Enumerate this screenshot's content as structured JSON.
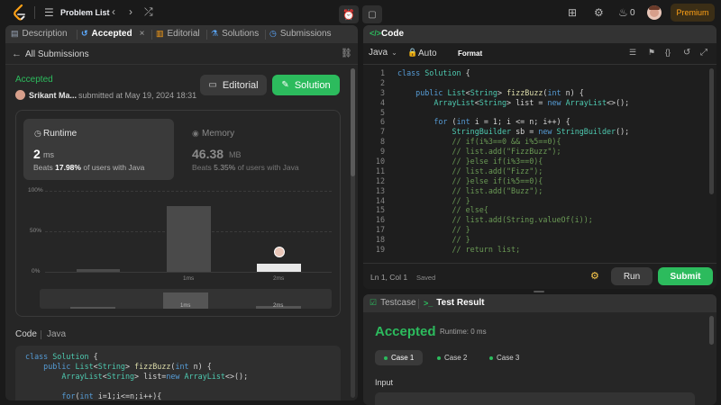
{
  "topbar": {
    "problem_list": "Problem List",
    "streak_count": "0",
    "premium_label": "Premium"
  },
  "left": {
    "tabs": [
      {
        "label": "Description"
      },
      {
        "label": "Accepted"
      },
      {
        "label": "Editorial"
      },
      {
        "label": "Solutions"
      },
      {
        "label": "Submissions"
      }
    ],
    "back_label": "All Submissions",
    "status": "Accepted",
    "user": "Srikant Ma...",
    "submitted": "submitted at May 19, 2024 18:31",
    "editorial_btn": "Editorial",
    "solution_btn": "Solution",
    "runtime": {
      "title": "Runtime",
      "value": "2",
      "unit": "ms",
      "beats_prefix": "Beats",
      "beats_pct": "17.98%",
      "beats_suffix": "of users with Java"
    },
    "memory": {
      "title": "Memory",
      "value": "46.38",
      "unit": "MB",
      "beats_prefix": "Beats",
      "beats_pct": "5.35%",
      "beats_suffix": "of users with Java"
    },
    "chart": {
      "y_ticks": [
        "100%",
        "50%",
        "0%"
      ],
      "x_labels": [
        "1ms",
        "2ms"
      ],
      "mini_labels": [
        "1ms",
        "2ms"
      ]
    },
    "code_label": "Code",
    "code_lang": "Java",
    "code_preview": [
      "class Solution {",
      "    public List<String> fizzBuzz(int n) {",
      "        ArrayList<String> list=new ArrayList<>();",
      "",
      "        for(int i=1;i<=n;i++){"
    ]
  },
  "editor": {
    "title": "Code",
    "language": "Java",
    "auto_label": "Auto",
    "format_label": "Format",
    "lines": [
      "class Solution {",
      "",
      "    public List<String> fizzBuzz(int n) {",
      "        ArrayList<String> list = new ArrayList<>();",
      "",
      "        for (int i = 1; i <= n; i++) {",
      "            StringBuilder sb = new StringBuilder();",
      "            // if(i%3==0 && i%5==0){",
      "            // list.add(\"FizzBuzz\");",
      "            // }else if(i%3==0){",
      "            // list.add(\"Fizz\");",
      "            // }else if(i%5==0){",
      "            // list.add(\"Buzz\");",
      "            // }",
      "            // else{",
      "            // list.add(String.valueOf(i));",
      "            // }",
      "            // }",
      "            // return list;"
    ],
    "cursor": "Ln 1, Col 1",
    "saved": "Saved",
    "run_label": "Run",
    "submit_label": "Submit"
  },
  "result": {
    "tab_testcase": "Testcase",
    "tab_result": "Test Result",
    "status": "Accepted",
    "runtime": "Runtime: 0 ms",
    "cases": [
      "Case 1",
      "Case 2",
      "Case 3"
    ],
    "input_label": "Input"
  },
  "colors": {
    "accent_green": "#2cbb5d",
    "premium": "#ffa116",
    "blue_tab": "#0a84ff"
  }
}
